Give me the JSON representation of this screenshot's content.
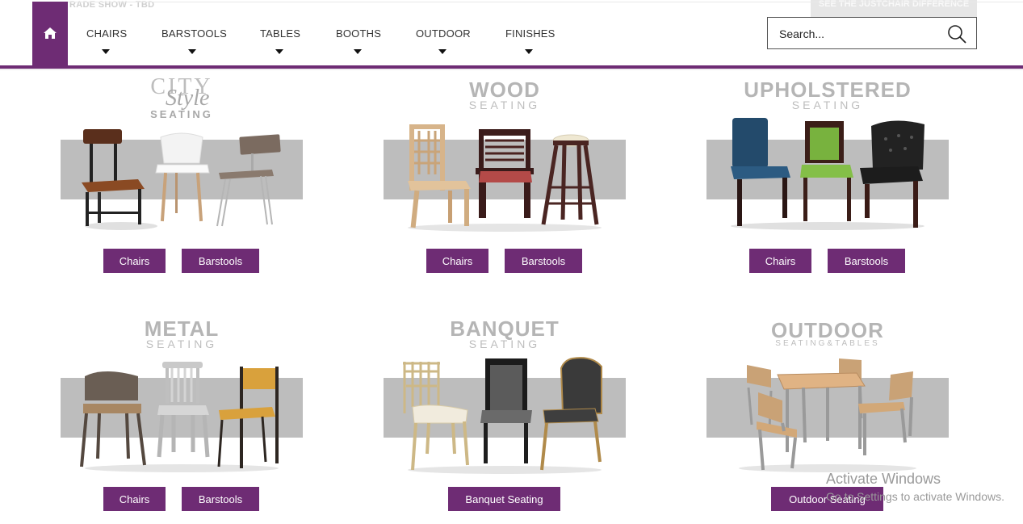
{
  "header": {
    "ghost_left": "RADE SHOW - TBD",
    "ghost_right": "SEE THE JUSTCHAIR DIFFERENCE",
    "nav": [
      {
        "label": "CHAIRS"
      },
      {
        "label": "BARSTOOLS"
      },
      {
        "label": "TABLES"
      },
      {
        "label": "BOOTHS"
      },
      {
        "label": "OUTDOOR"
      },
      {
        "label": "FINISHES"
      }
    ],
    "search_placeholder": "Search...",
    "accent": "#6e2c74"
  },
  "categories": [
    {
      "title": "CITY",
      "script": "Style",
      "sub": "SEATING",
      "buttons": [
        "Chairs",
        "Barstools"
      ]
    },
    {
      "title": "WOOD",
      "sub": "SEATING",
      "buttons": [
        "Chairs",
        "Barstools"
      ]
    },
    {
      "title": "UPHOLSTERED",
      "sub": "SEATING",
      "buttons": [
        "Chairs",
        "Barstools"
      ]
    },
    {
      "title": "METAL",
      "sub": "SEATING",
      "buttons": [
        "Chairs",
        "Barstools"
      ]
    },
    {
      "title": "BANQUET",
      "sub": "SEATING",
      "buttons": [
        "Banquet Seating"
      ]
    },
    {
      "title": "OUTDOOR",
      "sub": "SEATING&TABLES",
      "buttons": [
        "Outdoor Seating"
      ]
    }
  ],
  "watermark": {
    "line1": "Activate Windows",
    "line2": "Go to Settings to activate Windows."
  }
}
